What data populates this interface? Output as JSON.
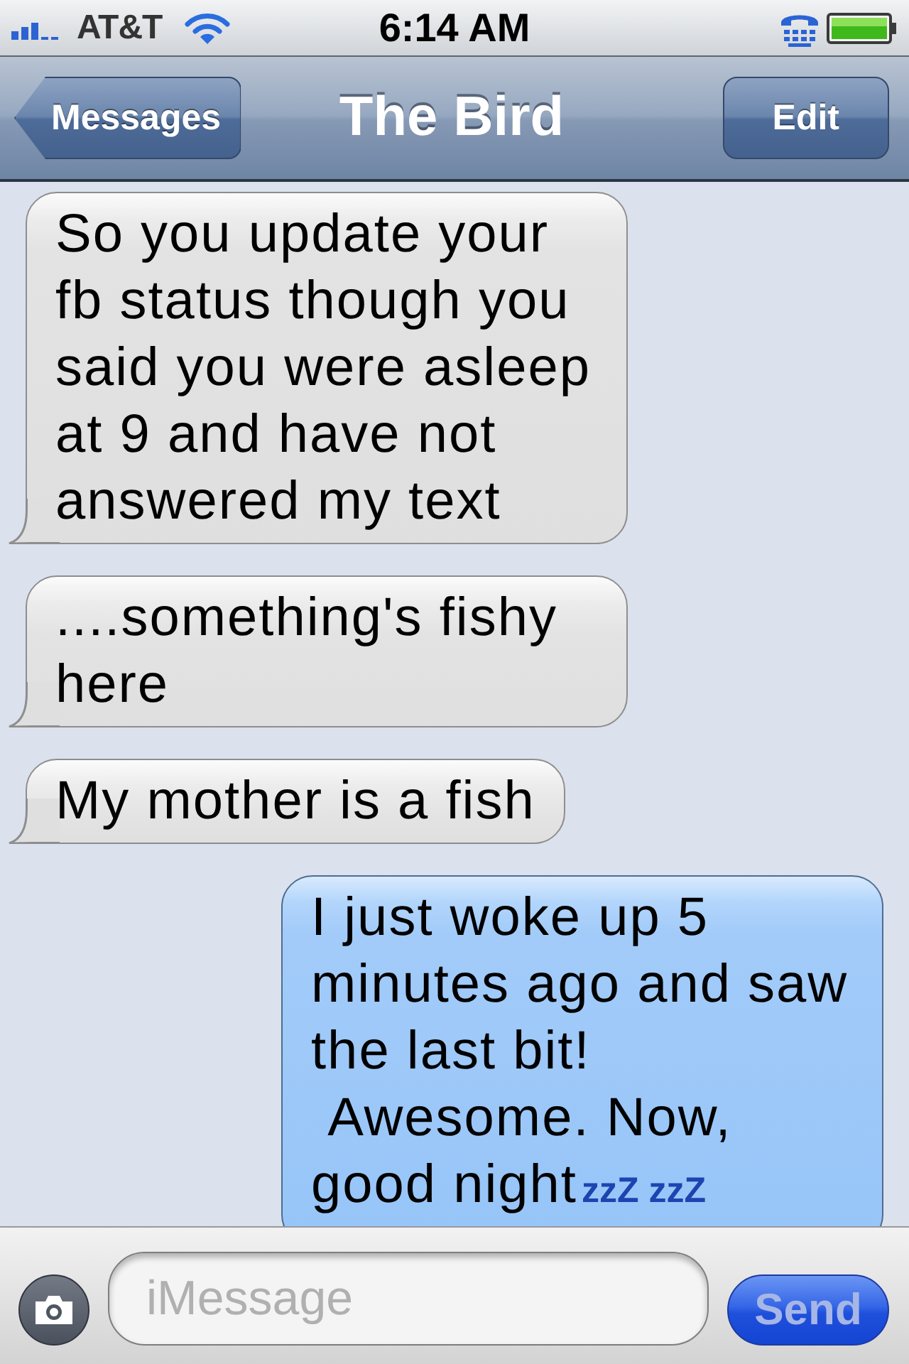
{
  "status_bar": {
    "carrier": "AT&T",
    "time": "6:14 AM"
  },
  "nav_bar": {
    "back_button": "Messages",
    "title": "The Bird",
    "edit_button": "Edit"
  },
  "messages": [
    {
      "kind": "received",
      "text": "So you update your fb status though you said you were asleep at 9 and have not answered my text"
    },
    {
      "kind": "received",
      "text": "....something's fishy here"
    },
    {
      "kind": "received",
      "text": "My mother is a fish"
    },
    {
      "kind": "sent",
      "text": "I just woke up 5 minutes ago and saw the last bit!\n Awesome. Now, good night**zzZ zzZ**"
    }
  ],
  "compose": {
    "placeholder": "iMessage",
    "send_button": {
      "label": "Send",
      "disabled": true
    }
  }
}
